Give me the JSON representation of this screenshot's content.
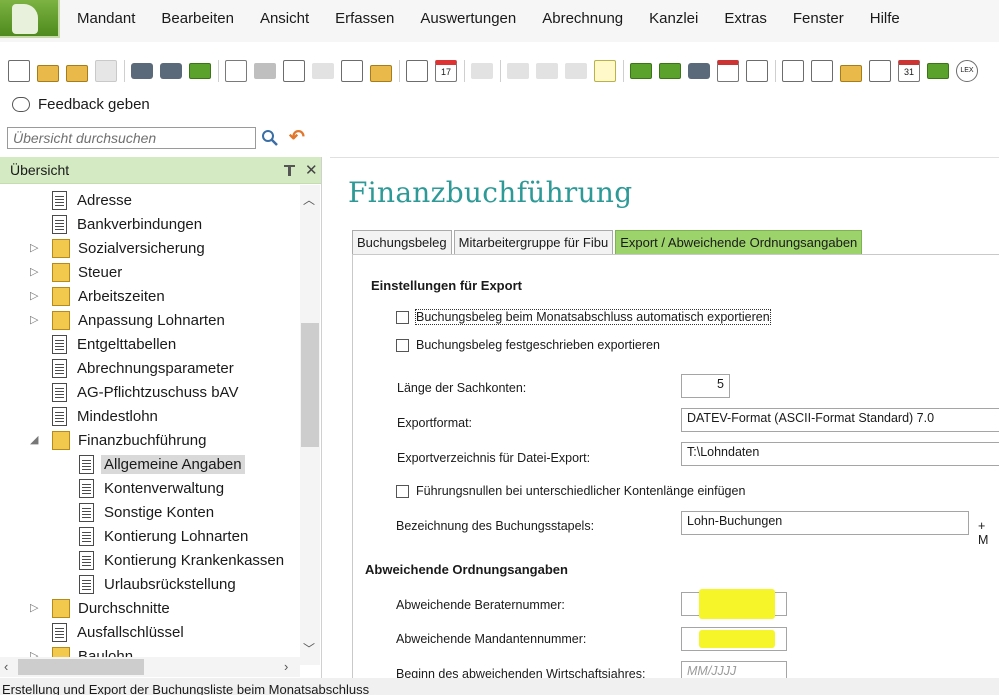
{
  "menubar": {
    "items": [
      "Mandant",
      "Bearbeiten",
      "Ansicht",
      "Erfassen",
      "Auswertungen",
      "Abrechnung",
      "Kanzlei",
      "Extras",
      "Fenster",
      "Hilfe"
    ]
  },
  "toolbar": {
    "icons": [
      "new-document-icon",
      "open-folder-icon",
      "close-folder-icon",
      "save-icon",
      "print-preview-icon",
      "print-icon",
      "export-icon",
      "send-dropdown-icon",
      "archive-icon",
      "card-icon",
      "handshake-icon",
      "checklist-icon",
      "frame-icon",
      "edit-list-icon",
      "calendar-17-icon",
      "undo-icon",
      "cut-icon",
      "copy-icon",
      "paste-icon",
      "tree-icon",
      "person-icon",
      "person-check-icon",
      "building-icon",
      "pen-icon",
      "calendar-icon",
      "import-icon",
      "export-doc-icon",
      "lock-icon",
      "info-doc-icon",
      "calendar-31-icon",
      "help-icon",
      "lexikon-icon"
    ],
    "calendar_17": "17",
    "calendar_31": "31",
    "lexikon": "LEX"
  },
  "feedback": {
    "label": "Feedback geben"
  },
  "search": {
    "placeholder": "Übersicht durchsuchen"
  },
  "sidebar": {
    "title": "Übersicht",
    "items": [
      {
        "label": "Adresse"
      },
      {
        "label": "Bankverbindungen"
      },
      {
        "label": "Sozialversicherung"
      },
      {
        "label": "Steuer"
      },
      {
        "label": "Arbeitszeiten"
      },
      {
        "label": "Anpassung Lohnarten"
      },
      {
        "label": "Entgelttabellen"
      },
      {
        "label": "Abrechnungsparameter"
      },
      {
        "label": "AG-Pflichtzuschuss bAV"
      },
      {
        "label": "Mindestlohn"
      },
      {
        "label": "Finanzbuchführung"
      },
      {
        "label": "Allgemeine Angaben"
      },
      {
        "label": "Kontenverwaltung"
      },
      {
        "label": "Sonstige Konten"
      },
      {
        "label": "Kontierung Lohnarten"
      },
      {
        "label": "Kontierung Krankenkassen"
      },
      {
        "label": "Urlaubsrückstellung"
      },
      {
        "label": "Durchschnitte"
      },
      {
        "label": "Ausfallschlüssel"
      },
      {
        "label": "Baulohn"
      }
    ]
  },
  "content": {
    "title": "Finanzbuchführung",
    "tabs": [
      "Buchungsbeleg",
      "Mitarbeitergruppe für Fibu",
      "Export / Abweichende Ordnungsangaben"
    ],
    "active_tab": "Export / Abweichende Ordnungsangaben",
    "export_section": {
      "title": "Einstellungen für Export",
      "check_auto": "Buchungsbeleg beim Monatsabschluss automatisch exportieren",
      "check_fixed": "Buchungsbeleg festgeschrieben exportieren",
      "length_label": "Länge der Sachkonten:",
      "length_value": "5",
      "format_label": "Exportformat:",
      "format_value": "DATEV-Format (ASCII-Format Standard) 7.0",
      "dir_label": "Exportverzeichnis für Datei-Export:",
      "dir_value": "T:\\Lohndaten",
      "check_zeros": "Führungsnullen bei unterschiedlicher Kontenlänge einfügen",
      "stack_label": "Bezeichnung des Buchungsstapels:",
      "stack_value": "Lohn-Buchungen",
      "stack_suffix": "+ M"
    },
    "deviating_section": {
      "title": "Abweichende Ordnungsangaben",
      "advisor_label": "Abweichende Beraternummer:",
      "client_label": "Abweichende Mandantennummer:",
      "fiscal_label": "Beginn des abweichenden Wirtschaftsjahres:",
      "fiscal_placeholder": "MM/JJJJ",
      "highlight_color": "#f5f52a"
    }
  },
  "statusbar": {
    "text": "Erstellung und Export der Buchungsliste beim Monatsabschluss"
  },
  "colors": {
    "accent_green": "#9cd36a",
    "title_teal": "#2e9a97",
    "header_green": "#d3eac2"
  }
}
